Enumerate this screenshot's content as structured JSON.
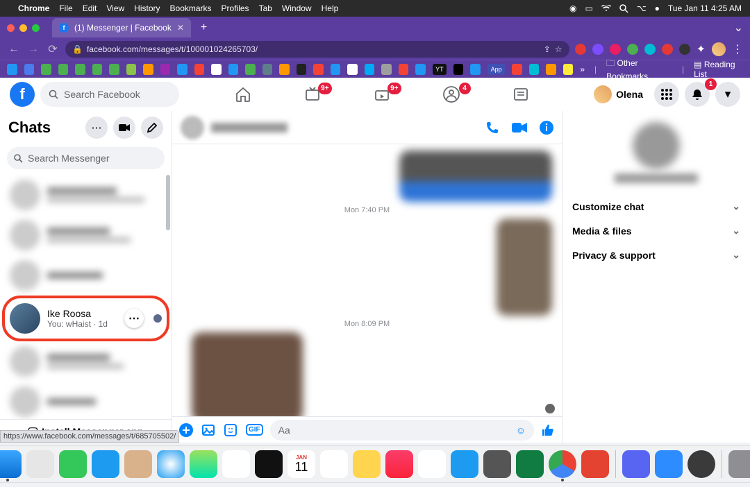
{
  "mac_menu": {
    "app": "Chrome",
    "items": [
      "File",
      "Edit",
      "View",
      "History",
      "Bookmarks",
      "Profiles",
      "Tab",
      "Window",
      "Help"
    ],
    "clock": "Tue Jan 11  4:25 AM"
  },
  "browser": {
    "tab_title": "(1) Messenger | Facebook",
    "url": "facebook.com/messages/t/100001024265703/",
    "other_bookmarks": "Other Bookmarks",
    "reading_list": "Reading List",
    "hover_url": "https://www.facebook.com/messages/t/685705502/"
  },
  "fb_header": {
    "search_placeholder": "Search Facebook",
    "badges": {
      "watch": "9+",
      "marketplace": "9+",
      "groups": "4",
      "notifications": "1"
    },
    "user_name": "Olena"
  },
  "chats": {
    "title": "Chats",
    "search_placeholder": "Search Messenger",
    "highlighted": {
      "name": "Ike Roosa",
      "preview": "You: wHaist · 1d"
    },
    "install_label": "Install Messenger app"
  },
  "conversation": {
    "timestamps": [
      "Mon 7:40 PM",
      "Mon 8:09 PM"
    ],
    "composer_placeholder": "Aa"
  },
  "details": {
    "rows": [
      "Customize chat",
      "Media & files",
      "Privacy & support"
    ]
  }
}
